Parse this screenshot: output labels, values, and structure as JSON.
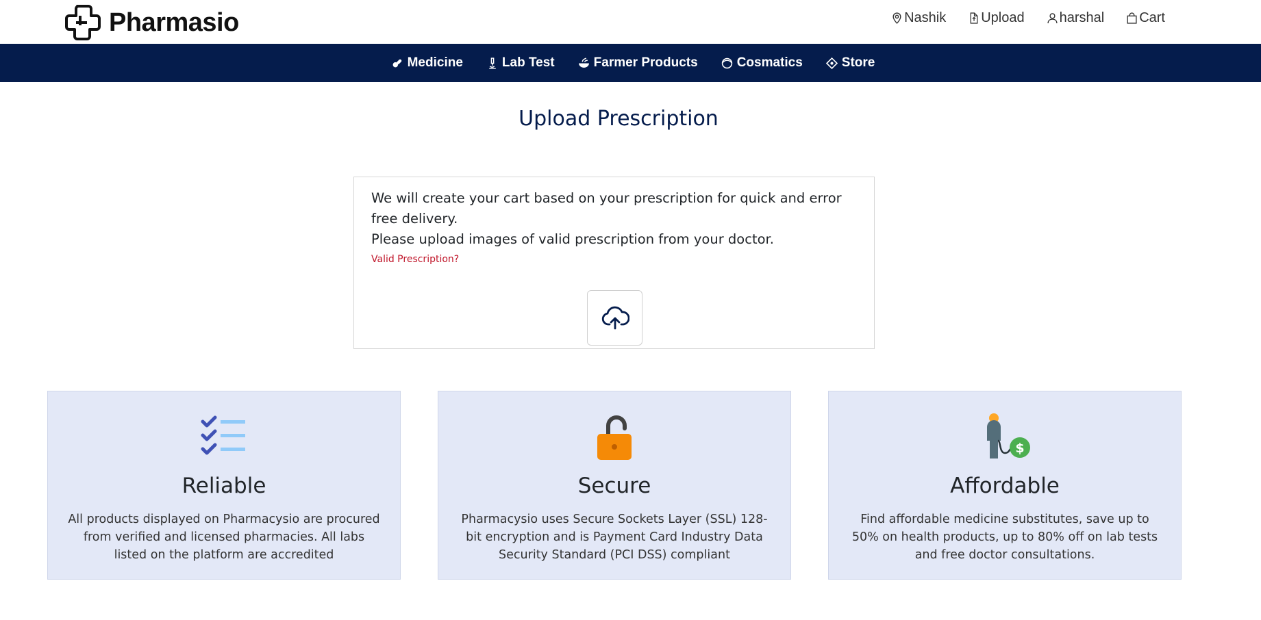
{
  "brand": {
    "name": "Pharmasio"
  },
  "top_links": [
    {
      "label": "Nashik",
      "icon": "location-pin-icon"
    },
    {
      "label": "Upload",
      "icon": "file-upload-icon"
    },
    {
      "label": "harshal",
      "icon": "user-icon"
    },
    {
      "label": "Cart",
      "icon": "shopping-bag-icon"
    }
  ],
  "nav": [
    {
      "label": "Medicine",
      "icon": "pills-icon"
    },
    {
      "label": "Lab Test",
      "icon": "microscope-icon"
    },
    {
      "label": "Farmer Products",
      "icon": "bowl-icon"
    },
    {
      "label": "Cosmatics",
      "icon": "face-icon"
    },
    {
      "label": "Store",
      "icon": "store-icon"
    }
  ],
  "page_title": "Upload Prescription",
  "upload": {
    "line1": "We will create your cart based on your prescription for quick and error free delivery.",
    "line2": "Please upload images of valid prescription from your doctor.",
    "valid_link": "Valid Prescription?",
    "button_icon": "cloud-upload-icon"
  },
  "features": [
    {
      "title": "Reliable",
      "icon": "checklist-icon",
      "text": "All products displayed on Pharmacysio are procured from verified and licensed pharmacies. All labs listed on the platform are accredited"
    },
    {
      "title": "Secure",
      "icon": "unlocked-padlock-icon",
      "text": "Pharmacysio uses Secure Sockets Layer (SSL) 128-bit encryption and is Payment Card Industry Data Security Standard (PCI DSS) compliant"
    },
    {
      "title": "Affordable",
      "icon": "person-money-icon",
      "text": "Find affordable medicine substitutes, save up to 50% on health products, up to 80% off on lab tests and free doctor consultations."
    }
  ],
  "colors": {
    "navbar": "#051c4c",
    "title": "#051c4c",
    "link_red": "#c0162a",
    "feature_bg": "#e3e8f7",
    "lock_orange": "#f58a07",
    "check_blue": "#3f51b5",
    "money_green": "#4caf50"
  }
}
